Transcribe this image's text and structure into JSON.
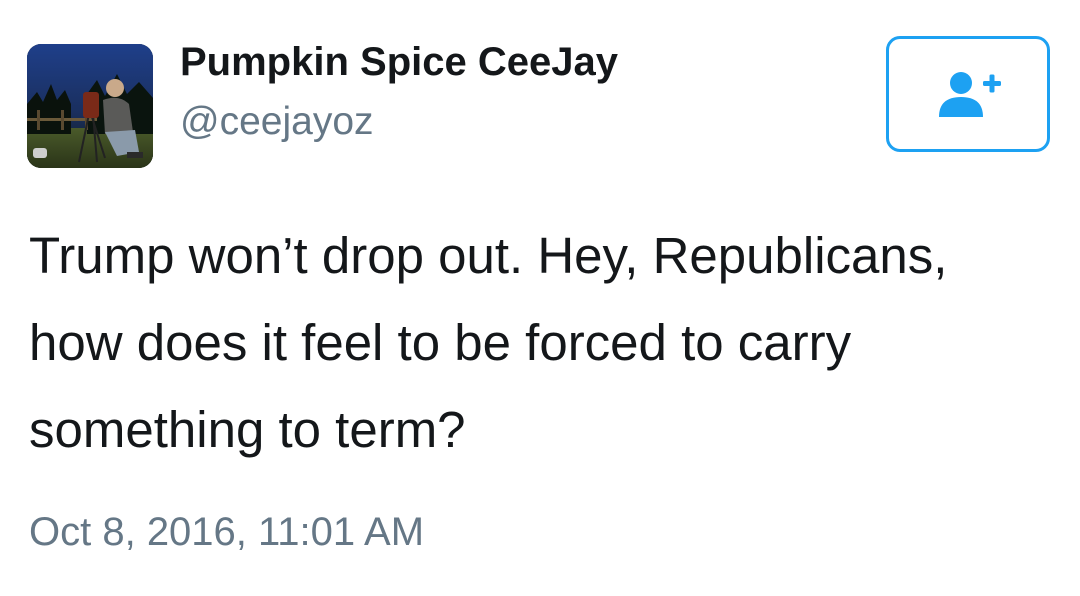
{
  "user": {
    "display_name": "Pumpkin Spice CeeJay",
    "handle": "@ceejayoz",
    "avatar_icon": "profile-photo"
  },
  "follow_button": {
    "icon": "add-user-icon",
    "accent_color": "#1da1f2"
  },
  "tweet": {
    "lines": [
      "Trump won’t drop out. Hey, Republicans,",
      "how does it feel to be forced to carry",
      "something to term?"
    ],
    "timestamp": "Oct 8, 2016, 11:01 AM"
  },
  "colors": {
    "text_primary": "#14171a",
    "text_secondary": "#657786",
    "accent": "#1da1f2"
  }
}
